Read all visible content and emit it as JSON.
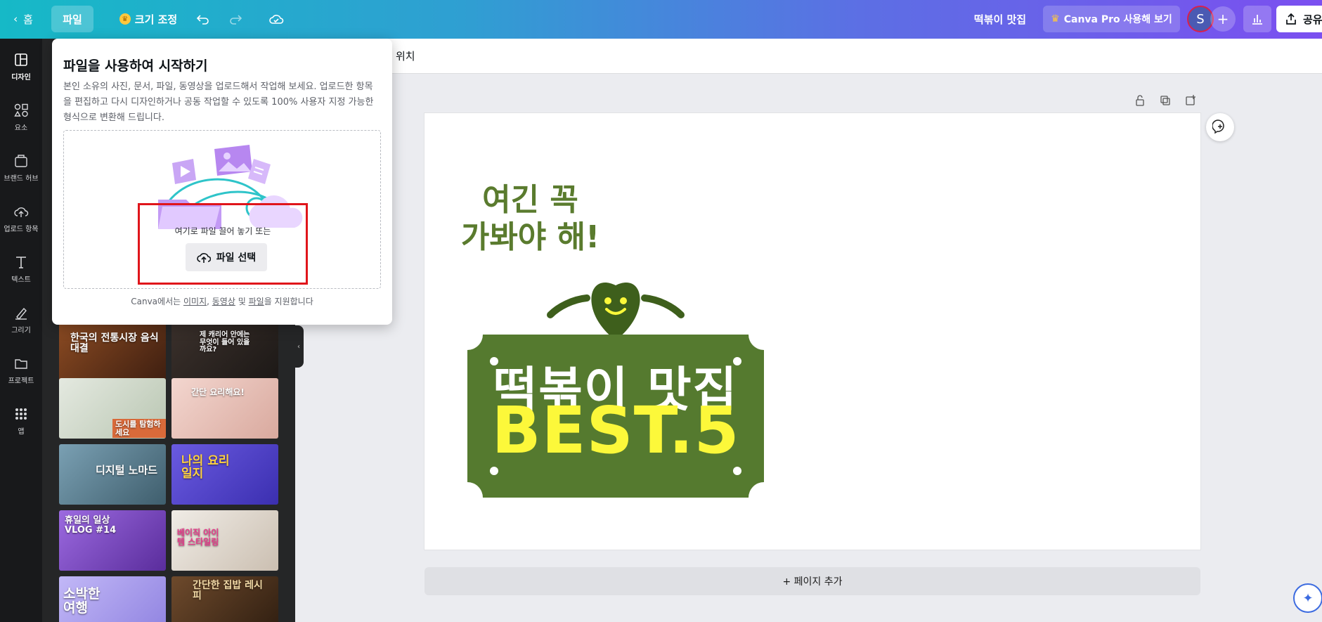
{
  "topbar": {
    "home": "홈",
    "file": "파일",
    "resize": "크기 조정",
    "doc_title": "떡볶이 맛집",
    "pro": "Canva Pro 사용해 보기",
    "avatar": "S",
    "share": "공유"
  },
  "rail": [
    {
      "label": "디자인",
      "icon": "layout-icon"
    },
    {
      "label": "요소",
      "icon": "elements-icon"
    },
    {
      "label": "브랜드 허브",
      "icon": "brand-hub-icon"
    },
    {
      "label": "업로드 항목",
      "icon": "upload-icon"
    },
    {
      "label": "텍스트",
      "icon": "text-icon"
    },
    {
      "label": "그리기",
      "icon": "draw-icon"
    },
    {
      "label": "프로젝트",
      "icon": "folder-icon"
    },
    {
      "label": "앱",
      "icon": "apps-icon"
    }
  ],
  "context": {
    "position": "위치"
  },
  "popover": {
    "title": "파일을 사용하여 시작하기",
    "description": "본인 소유의 사진, 문서, 파일, 동영상을 업로드해서 작업해 보세요. 업로드한 항목을 편집하고 다시 디자인하거나 공동 작업할 수 있도록 100% 사용자 지정 가능한 형식으로 변환해 드립니다.",
    "drop_text": "여기로 파일 끌어 놓기 또는",
    "choose_button": "파일 선택",
    "foot_prefix": "Canva에서는",
    "foot_images": "이미지",
    "foot_sep": ",",
    "foot_videos": "동영상",
    "foot_and": "및",
    "foot_files": "파일",
    "foot_suffix": "을 지원합니다"
  },
  "templates": [
    {
      "text": "한국의 전통시장 음식 대결",
      "bg": "#6b3a1f"
    },
    {
      "text": "제 캐리어 안에는 무엇이 들어 있을까요?",
      "bg": "#2b2522"
    },
    {
      "text": "도시를 탐험하세요",
      "bg": "#cfd6c8"
    },
    {
      "text": "간단 요리해요!",
      "bg": "#e9c9c2"
    },
    {
      "text": "디지털 노마드",
      "bg": "#5a7e92"
    },
    {
      "text": "나의 요리 일지",
      "bg": "#5548c7"
    },
    {
      "text": "휴일의 일상 VLOG #14",
      "bg": "#8a55d0"
    },
    {
      "text": "베이직 아이템 스타일링",
      "bg": "#e6e0d8"
    },
    {
      "text": "소박한 여행",
      "bg": "#b3a7f2"
    },
    {
      "text": "간단한 집밥 레시피",
      "bg": "#4a3320"
    }
  ],
  "design": {
    "headline": "여긴 꼭\n가봐야 해!",
    "line1": "떡볶이 맛집",
    "line2": "BEST.5",
    "colors": {
      "green": "#557a2f",
      "dark_green": "#3e5f1c",
      "yellow": "#fcf83a"
    }
  },
  "add_page": "+ 페이지 추가"
}
